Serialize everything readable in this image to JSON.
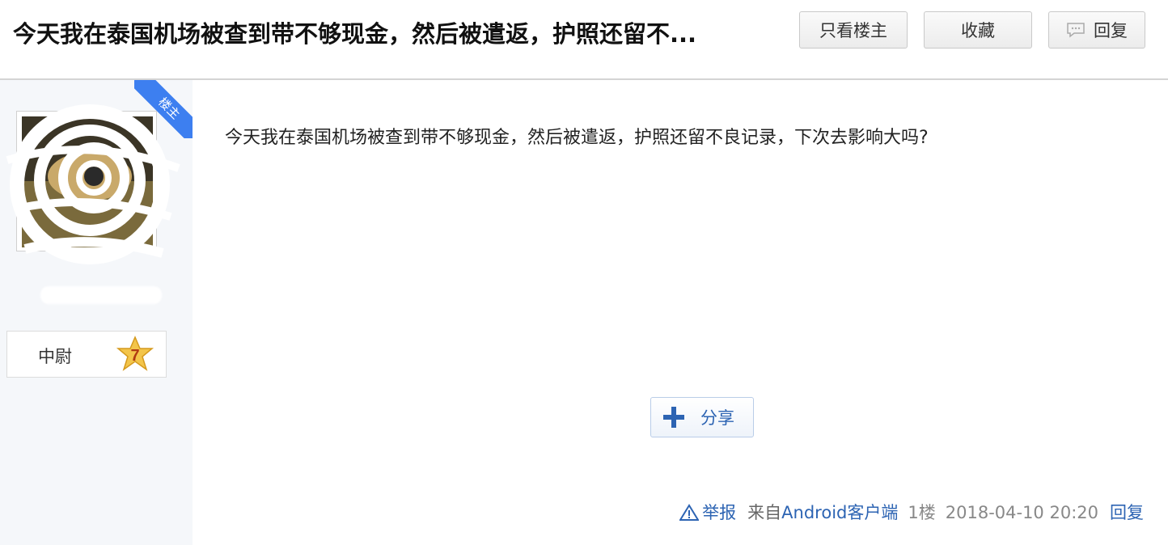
{
  "header": {
    "title": "今天我在泰国机场被查到带不够现金，然后被遣返，护照还留不...",
    "buttons": {
      "only_op": "只看楼主",
      "favorite": "收藏",
      "reply": "回复"
    }
  },
  "sidebar": {
    "badge": "楼主",
    "rank": {
      "title": "中尉",
      "level": "7"
    },
    "icons": {
      "rank_star": "star-badge-icon"
    }
  },
  "post": {
    "content": "今天我在泰国机场被查到带不够现金，然后被遣返，护照还留不良记录，下次去影响大吗?",
    "share_label": "分享"
  },
  "footer": {
    "report": "举报",
    "from": "来自",
    "client": "Android客户端",
    "floor": "1楼",
    "time": "2018-04-10 20:20",
    "reply": "回复"
  },
  "colors": {
    "accent": "#2d64b3",
    "badge": "#3d7ff0",
    "sidebar_bg": "#f5f7fa"
  }
}
